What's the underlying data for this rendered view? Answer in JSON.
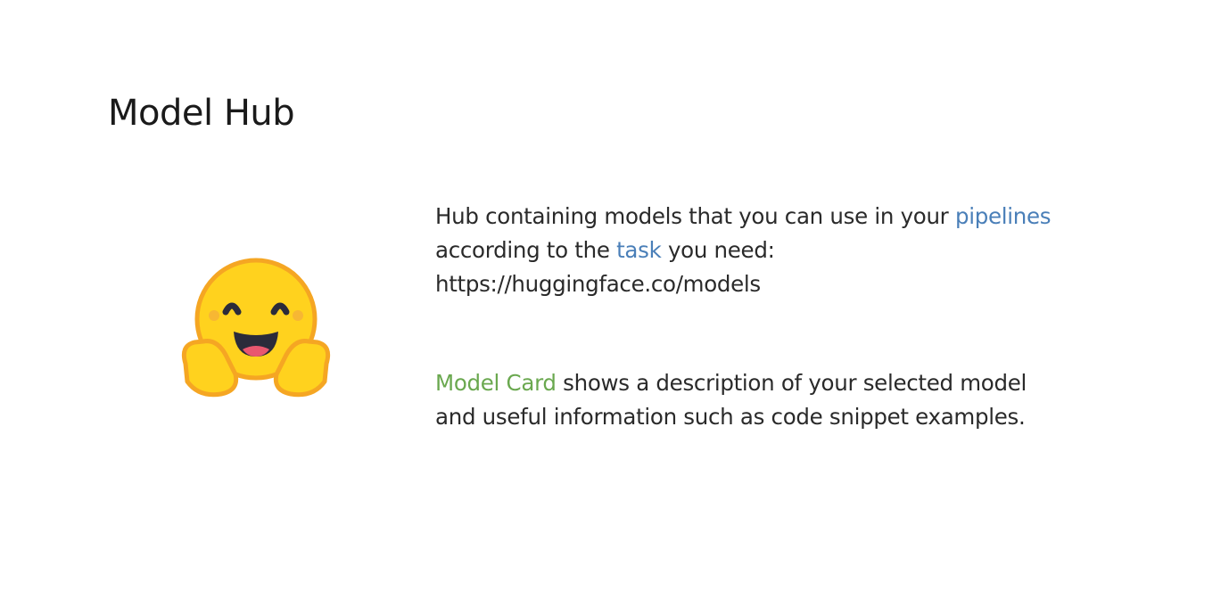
{
  "slide": {
    "title": "Model Hub",
    "logo_icon": "hugging-face-emoji-icon",
    "paragraph1": {
      "text_before": "Hub containing models that you can use in your ",
      "link1": "pipelines",
      "text_middle": " according to the ",
      "link2": "task",
      "text_after": " you need:",
      "url": "https://huggingface.co/models"
    },
    "paragraph2": {
      "highlight": "Model Card",
      "text": " shows a description of your selected model and useful information such as code snippet examples."
    },
    "colors": {
      "link": "#4a7fb8",
      "highlight": "#6aa84f",
      "emoji": "#FFD21E"
    }
  }
}
